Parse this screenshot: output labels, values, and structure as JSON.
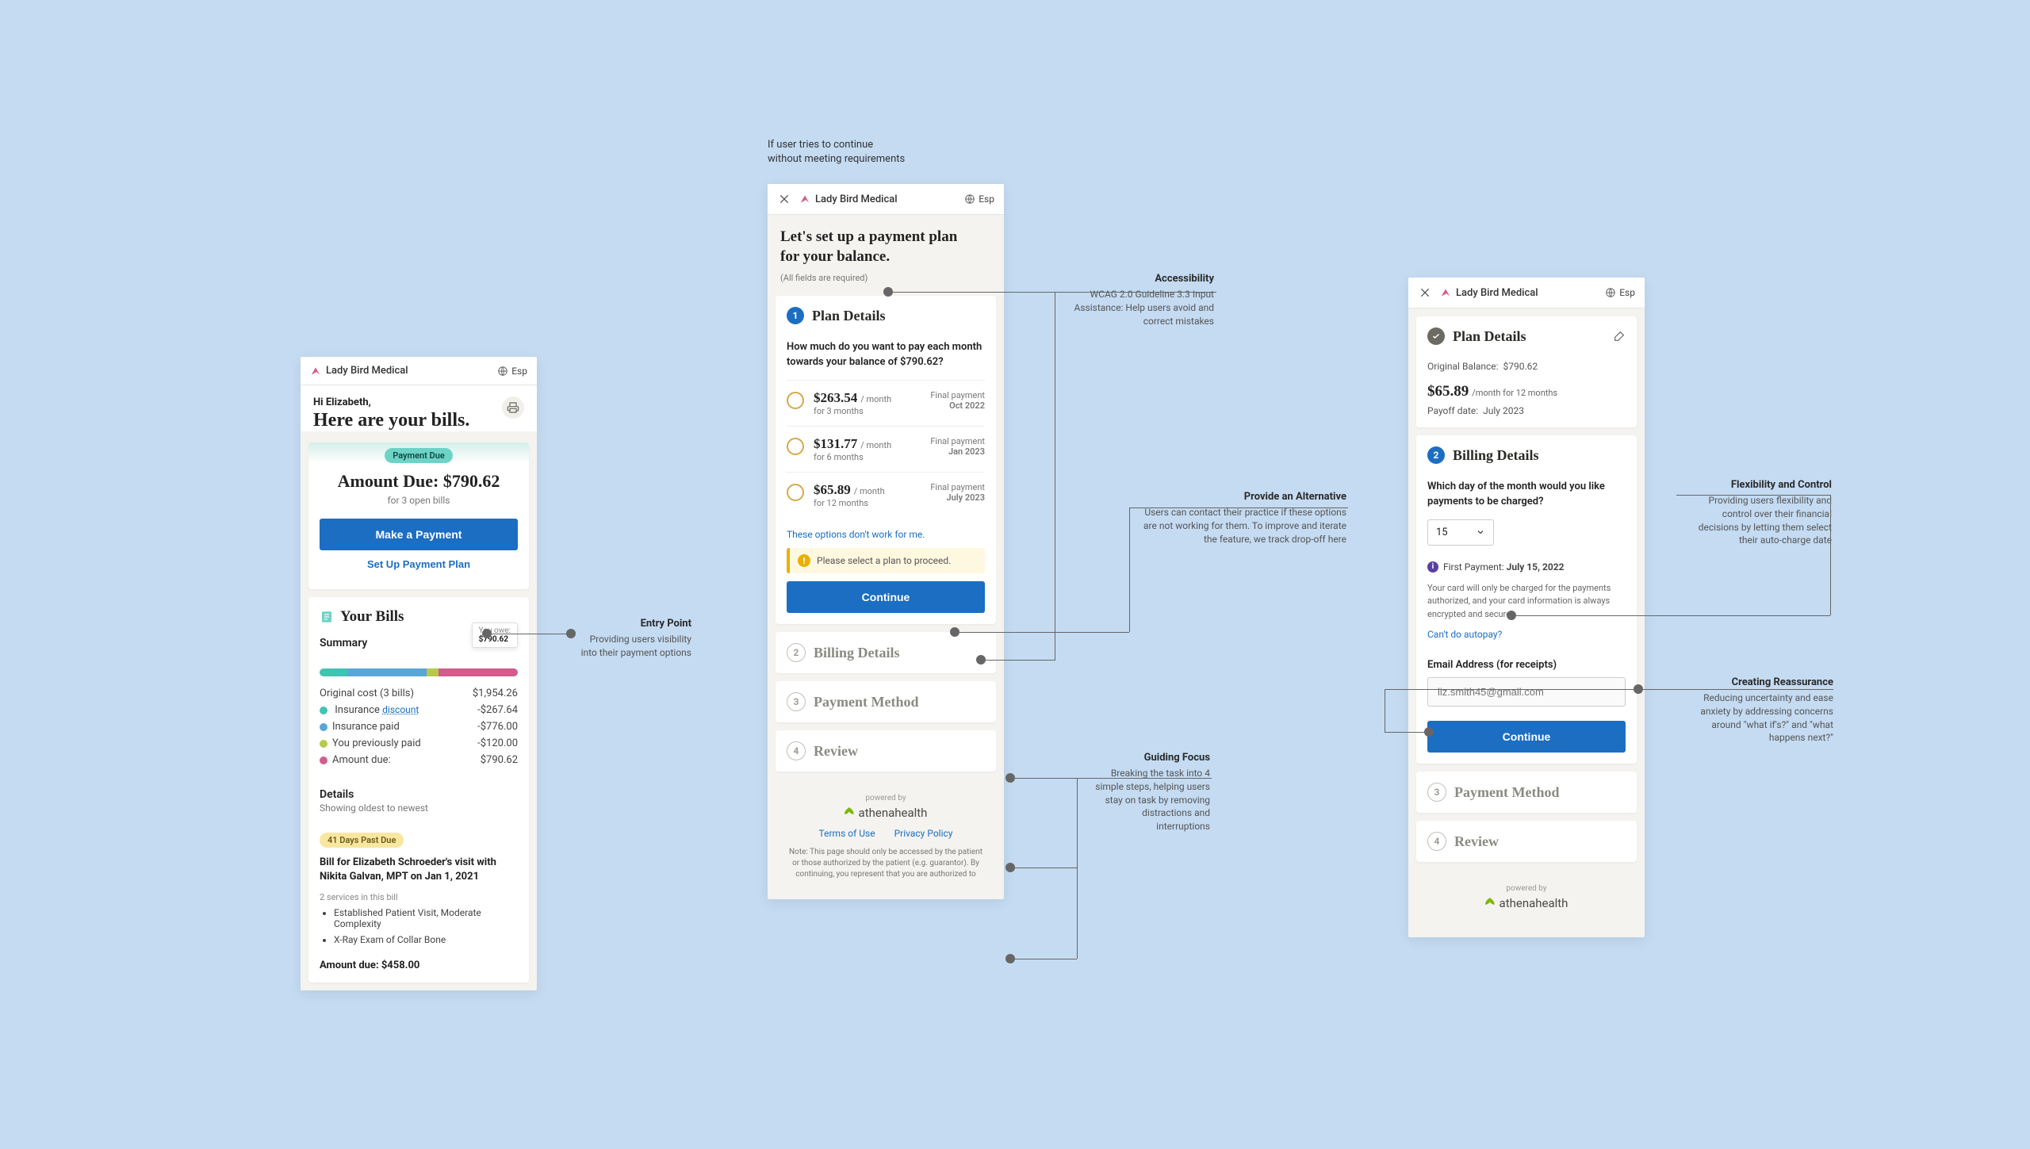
{
  "caption_error": "If user tries to continue\nwithout meeting requirements",
  "phone1": {
    "brand": "Lady Bird Medical",
    "lang": "Esp",
    "greeting": "Hi Elizabeth,",
    "headline": "Here are your bills.",
    "badge_payment_due": "Payment Due",
    "amount_due_label": "Amount Due:",
    "amount_due_value": "$790.62",
    "open_bills": "for 3 open bills",
    "btn_make_payment": "Make a Payment",
    "btn_setup_plan": "Set Up Payment Plan",
    "your_bills_title": "Your Bills",
    "summary_label": "Summary",
    "tooltip_label": "You owe:",
    "tooltip_value": "$790.62",
    "lines": [
      {
        "label": "Original cost (3 bills)",
        "value": "$1,954.26",
        "dot": null,
        "link": null
      },
      {
        "label": "Insurance ",
        "link": "discount",
        "value": "-$267.64",
        "dot": "#41c3b4"
      },
      {
        "label": "Insurance paid",
        "value": "-$776.00",
        "dot": "#5aa6d8",
        "link": null
      },
      {
        "label": "You previously paid",
        "value": "-$120.00",
        "dot": "#b7c94a",
        "link": null
      },
      {
        "label": "Amount due:",
        "value": "$790.62",
        "dot": "#d35c8b",
        "link": null
      }
    ],
    "details_label": "Details",
    "details_sub": "Showing oldest to newest",
    "past_due_pill": "41 Days Past Due",
    "bill_title": "Bill for Elizabeth Schroeder's visit with Nikita Galvan, MPT on Jan 1, 2021",
    "services_count": "2 services in this bill",
    "service1": "Established Patient Visit, Moderate Complexity",
    "service2": "X-Ray Exam of Collar Bone",
    "bill_amount_label": "Amount due: $458.00"
  },
  "phone2": {
    "brand": "Lady Bird Medical",
    "lang": "Esp",
    "heading": "Let's set up a payment plan for your balance.",
    "required_note": "(All fields are required)",
    "step1_title": "Plan Details",
    "question": "How much do you want to pay each month towards your balance of $790.62?",
    "options": [
      {
        "amount": "$263.54",
        "per": "/ month",
        "term": "for 3 months",
        "final_label": "Final payment",
        "final_date": "Oct 2022"
      },
      {
        "amount": "$131.77",
        "per": "/ month",
        "term": "for 6 months",
        "final_label": "Final payment",
        "final_date": "Jan 2023"
      },
      {
        "amount": "$65.89",
        "per": "/ month",
        "term": "for 12 months",
        "final_label": "Final payment",
        "final_date": "July 2023"
      }
    ],
    "dont_work_link": "These options don't work for me.",
    "alert_text": "Please select a plan to proceed.",
    "btn_continue": "Continue",
    "step2_title": "Billing Details",
    "step3_title": "Payment Method",
    "step4_title": "Review",
    "powered_by": "powered by",
    "ah_brand": "athenahealth",
    "tos": "Terms of Use",
    "privacy": "Privacy Policy",
    "footnote": "Note: This page should only be accessed by the patient or those authorized by the patient (e.g. guarantor). By continuing, you represent that you are authorized to"
  },
  "phone3": {
    "brand": "Lady Bird Medical",
    "lang": "Esp",
    "step1_title": "Plan Details",
    "orig_balance_label": "Original Balance:",
    "orig_balance_value": "$790.62",
    "monthly_amount": "$65.89",
    "monthly_suffix": "/month for 12 months",
    "payoff_label": "Payoff date:",
    "payoff_value": "July 2023",
    "step2_title": "Billing Details",
    "question": "Which day of the month would you like payments to be charged?",
    "select_value": "15",
    "first_payment_label": "First Payment:",
    "first_payment_value": "July 15, 2022",
    "reassurance": "Your card will only be charged for the payments authorized, and your card information is always encrypted and secure.",
    "cant_autopay": "Can't do autopay?",
    "email_label": "Email Address (for receipts)",
    "email_placeholder": "liz.smith45@gmail.com",
    "btn_continue": "Continue",
    "step3_title": "Payment Method",
    "step4_title": "Review",
    "powered_by": "powered by",
    "ah_brand": "athenahealth"
  },
  "annotations": {
    "entry": {
      "title": "Entry Point",
      "body": "Providing users visibility into their payment options"
    },
    "accessibility": {
      "title": "Accessibility",
      "body": "WCAG 2.0 Guideline 3.3 Input Assistance: Help users avoid and correct mistakes"
    },
    "alternative": {
      "title": "Provide an Alternative",
      "body": "Users can contact their practice if these options are not working for them. To improve and iterate the feature, we track drop-off here"
    },
    "guiding": {
      "title": "Guiding Focus",
      "body": "Breaking the task into 4 simple steps, helping users stay on task by removing distractions and interruptions"
    },
    "flexibility": {
      "title": "Flexibility and Control",
      "body": "Providing users flexibility and control over their financial decisions by letting them select their auto-charge date"
    },
    "reassurance": {
      "title": "Creating Reassurance",
      "body": "Reducing uncertainty and ease anxiety by addressing concerns around \"what if's?\" and \"what happens next?\""
    }
  }
}
